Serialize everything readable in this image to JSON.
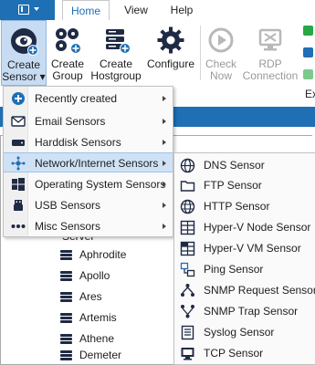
{
  "tabs": [
    {
      "label": "Home",
      "active": true
    },
    {
      "label": "View",
      "active": false
    },
    {
      "label": "Help",
      "active": false
    }
  ],
  "ribbon": {
    "create_sensor": "Create\nSensor ▾",
    "create_group": "Create\nGroup",
    "create_hostgroup": "Create\nHostgroup",
    "configure": "Configure",
    "check_now": "Check\nNow",
    "rdp_connection": "RDP\nConnection",
    "overflow_label": "Ex"
  },
  "colors": {
    "accent": "#1e6fb4",
    "hover": "#cfe2f5",
    "dark_icon": "#1f2a44"
  },
  "menu": {
    "items": [
      {
        "label": "Recently created",
        "icon": "recent-plus-icon",
        "has_submenu": true,
        "hot": false
      },
      {
        "label": "Email Sensors",
        "icon": "email-icon",
        "has_submenu": true,
        "hot": false
      },
      {
        "label": "Harddisk Sensors",
        "icon": "harddisk-icon",
        "has_submenu": true,
        "hot": false
      },
      {
        "label": "Network/Internet Sensors",
        "icon": "network-icon",
        "has_submenu": true,
        "hot": true
      },
      {
        "label": "Operating System Sensors",
        "icon": "windows-icon",
        "has_submenu": true,
        "hot": false
      },
      {
        "label": "USB Sensors",
        "icon": "usb-icon",
        "has_submenu": true,
        "hot": false
      },
      {
        "label": "Misc Sensors",
        "icon": "dots-icon",
        "has_submenu": true,
        "hot": false
      }
    ]
  },
  "submenu": {
    "items": [
      {
        "label": "DNS Sensor",
        "icon": "dns-icon"
      },
      {
        "label": "FTP Sensor",
        "icon": "ftp-folder-icon"
      },
      {
        "label": "HTTP Sensor",
        "icon": "http-globe-icon"
      },
      {
        "label": "Hyper-V Node Sensor",
        "icon": "hyperv-node-icon"
      },
      {
        "label": "Hyper-V VM Sensor",
        "icon": "hyperv-vm-icon"
      },
      {
        "label": "Ping Sensor",
        "icon": "ping-icon"
      },
      {
        "label": "SNMP Request Sensor",
        "icon": "snmp-request-icon"
      },
      {
        "label": "SNMP Trap Sensor",
        "icon": "snmp-trap-icon"
      },
      {
        "label": "Syslog Sensor",
        "icon": "syslog-icon"
      },
      {
        "label": "TCP Sensor",
        "icon": "tcp-icon"
      }
    ]
  },
  "tree": {
    "group_label": "Server",
    "nodes": [
      "Aphrodite",
      "Apollo",
      "Ares",
      "Artemis",
      "Athene",
      "Demeter"
    ]
  }
}
